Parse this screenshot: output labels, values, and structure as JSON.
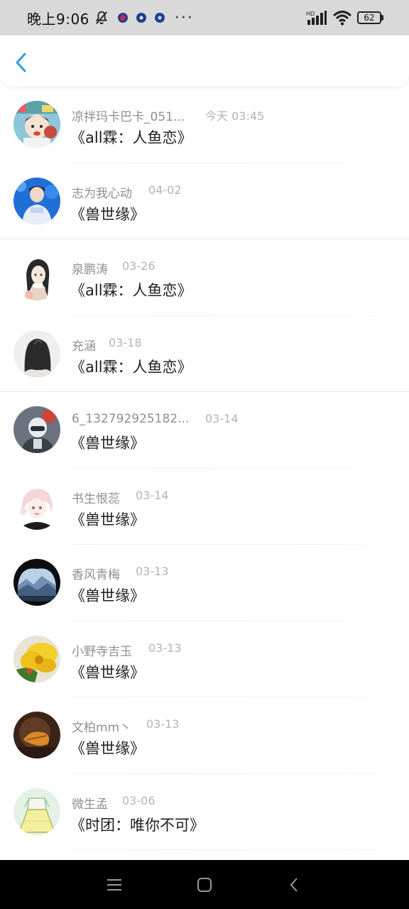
{
  "status_bar": {
    "time": "晚上9:06",
    "more": "···",
    "signal_label": "HD",
    "battery": "62",
    "icons": [
      "mute-bell-icon",
      "app-notification-icon",
      "app-notification-icon",
      "app-notification-icon",
      "hd-signal-icon",
      "wifi-icon",
      "battery-icon"
    ]
  },
  "header": {
    "back_icon": "chevron-left-icon"
  },
  "accent_color": "#2f9fe0",
  "items": [
    {
      "name": "凉拌玛卡巴卡_051...",
      "date": "今天 03:45",
      "title": "《all霖：人鱼恋》"
    },
    {
      "name": "志为我心动",
      "date": "04-02",
      "title": "《兽世缘》"
    },
    {
      "name": "泉鹏涛",
      "date": "03-26",
      "title": "《all霖：人鱼恋》"
    },
    {
      "name": "充涵",
      "date": "03-18",
      "title": "《all霖：人鱼恋》"
    },
    {
      "name": "6_132792925182...",
      "date": "03-14",
      "title": "《兽世缘》"
    },
    {
      "name": "书生恨蕊",
      "date": "03-14",
      "title": "《兽世缘》"
    },
    {
      "name": "香风青梅",
      "date": "03-13",
      "title": "《兽世缘》"
    },
    {
      "name": "小野寺吉玉",
      "date": "03-13",
      "title": "《兽世缘》"
    },
    {
      "name": "文柏mm丶",
      "date": "03-13",
      "title": "《兽世缘》"
    },
    {
      "name": "微生孟",
      "date": "03-06",
      "title": "《时团：唯你不可》"
    }
  ],
  "nav_bar": {
    "icons": [
      "menu-icon",
      "home-icon",
      "back-icon"
    ]
  }
}
